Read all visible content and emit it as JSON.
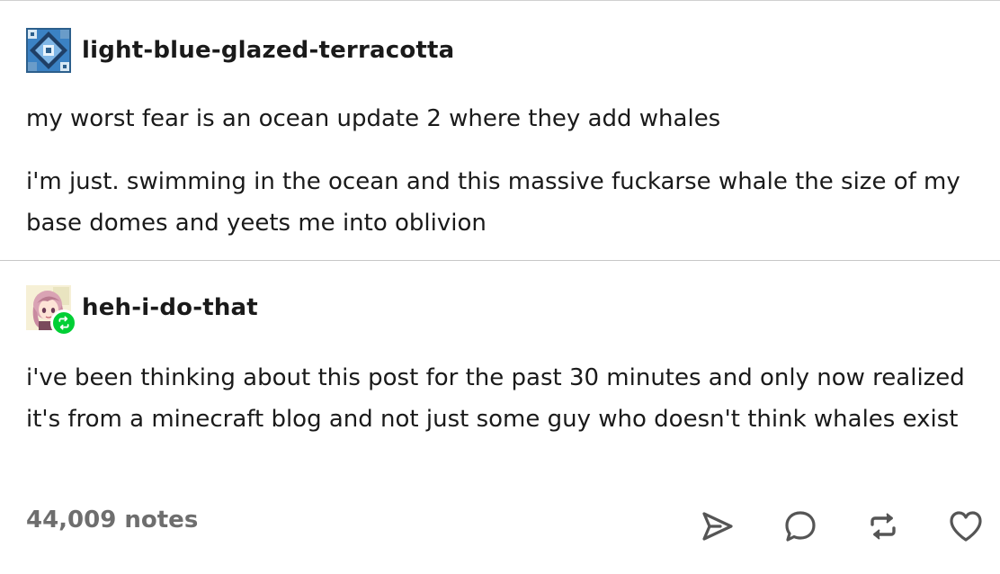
{
  "post": {
    "reblogs": [
      {
        "username": "light-blue-glazed-terracotta",
        "avatar_icon": "glazed-terracotta-block-icon",
        "paragraphs": [
          "my worst fear is an ocean update 2 where they add whales",
          "i'm just. swimming in the ocean and this massive fuckarse whale the size of my base domes and yeets me into oblivion"
        ]
      },
      {
        "username": "heh-i-do-that",
        "avatar_icon": "anime-girl-avatar-icon",
        "badge_icon": "reblog-icon",
        "paragraphs": [
          "i've been thinking about this post for the past 30 minutes and only now realized it's from a minecraft blog and not just some guy who doesn't think whales exist"
        ]
      }
    ],
    "footer": {
      "notes": "44,009 notes",
      "actions": [
        "share-icon",
        "reply-icon",
        "reblog-icon",
        "like-icon"
      ]
    }
  },
  "colors": {
    "text": "#1a1a1a",
    "muted": "#6e6e6e",
    "divider": "#c8c8c8",
    "reblog_green": "#00cf35"
  }
}
